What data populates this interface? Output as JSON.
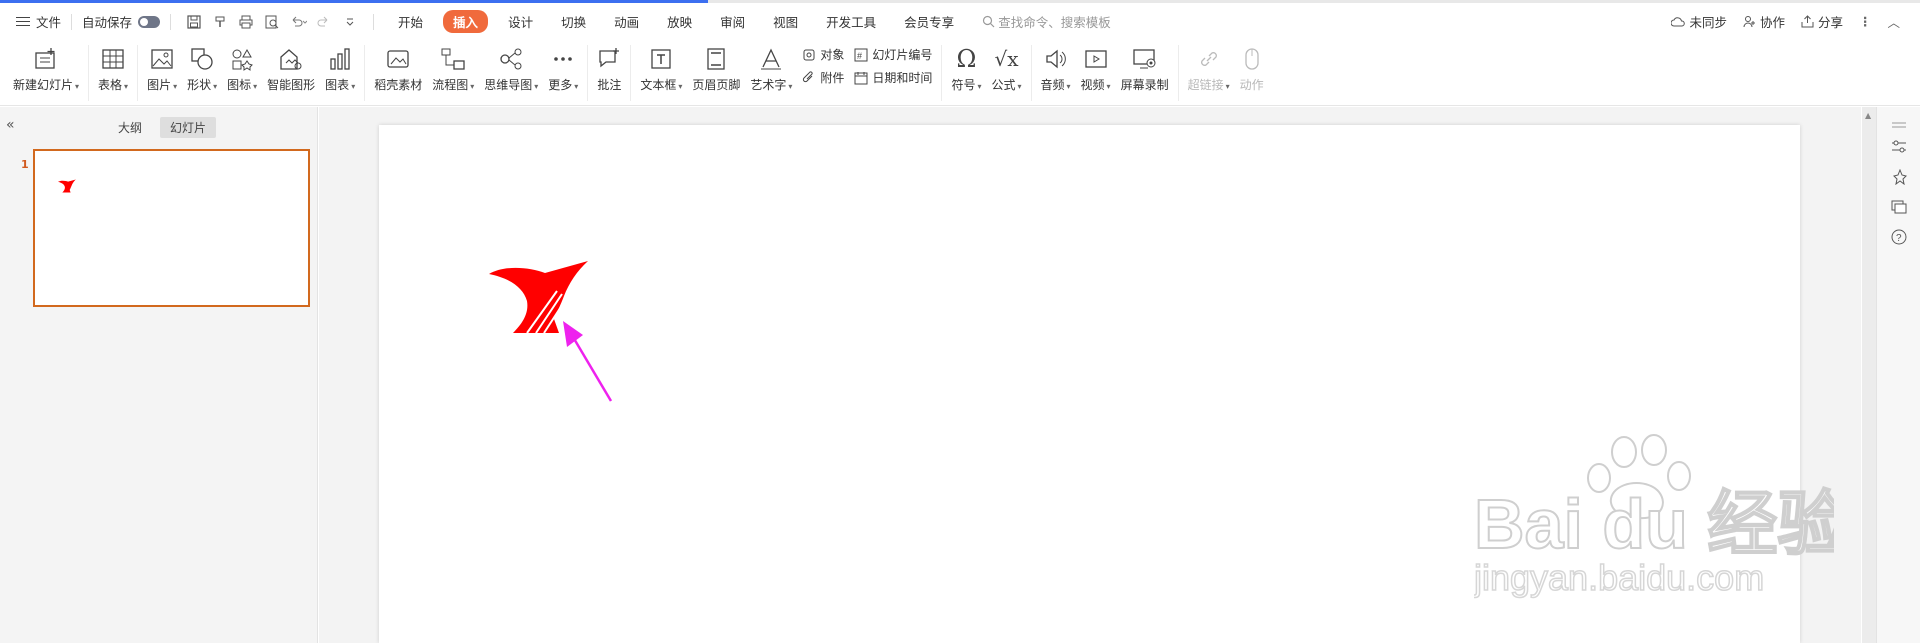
{
  "menu": {
    "file": "文件",
    "autosave": "自动保存",
    "tabs": [
      "开始",
      "插入",
      "设计",
      "切换",
      "动画",
      "放映",
      "审阅",
      "视图",
      "开发工具",
      "会员专享"
    ],
    "active_tab_index": 1,
    "search_placeholder": "查找命令、搜索模板",
    "right": {
      "sync": "未同步",
      "collab": "协作",
      "share": "分享"
    }
  },
  "ribbon": {
    "new_slide": "新建幻灯片",
    "table": "表格",
    "picture": "图片",
    "shape": "形状",
    "icon": "图标",
    "smart_graphic": "智能图形",
    "chart": "图表",
    "docer": "稻壳素材",
    "flowchart": "流程图",
    "mindmap": "思维导图",
    "more": "更多",
    "comment": "批注",
    "textbox": "文本框",
    "header_footer": "页眉页脚",
    "wordart": "艺术字",
    "object": "对象",
    "attachment": "附件",
    "slide_number": "幻灯片编号",
    "datetime": "日期和时间",
    "symbol": "符号",
    "formula": "公式",
    "audio": "音频",
    "video": "视频",
    "screen_record": "屏幕录制",
    "hyperlink": "超链接",
    "action": "动作"
  },
  "panel": {
    "outline_tab": "大纲",
    "slides_tab": "幻灯片",
    "slide_number": "1"
  },
  "colors": {
    "accent_tab": "#f06a3c",
    "logo_red": "#ff0000",
    "arrow_magenta": "#ee22ee",
    "thumb_border": "#d2691e"
  },
  "watermark": {
    "brand": "Bai du 经验",
    "url": "jingyan.baidu.com"
  }
}
